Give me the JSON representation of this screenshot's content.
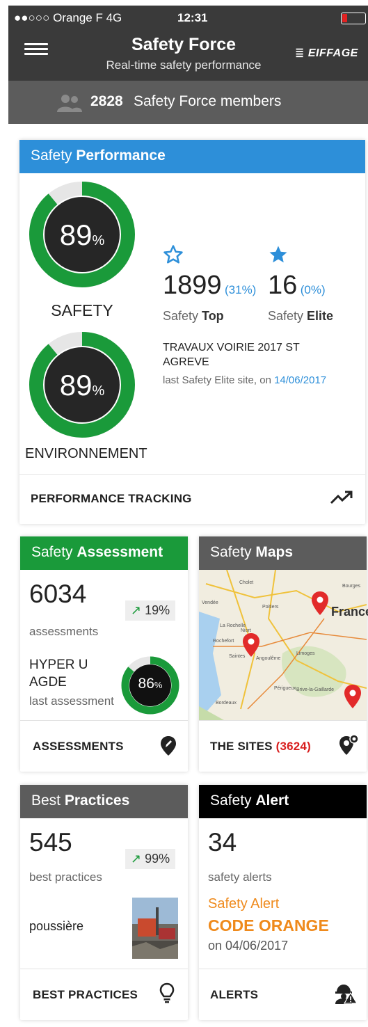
{
  "status_bar": {
    "carrier": "●●○○○ Orange F  4G",
    "time": "12:31"
  },
  "header": {
    "title": "Safety Force",
    "subtitle": "Real-time safety performance",
    "brand": "EIFFAGE",
    "menu_icon": "hamburger-icon"
  },
  "members": {
    "count": "2828",
    "label": "Safety Force members",
    "icon": "users-icon"
  },
  "performance": {
    "head_light": "Safety ",
    "head_bold": "Performance",
    "safety": {
      "value": "89",
      "unit": "%",
      "label": "SAFETY",
      "percent": 89
    },
    "environment": {
      "value": "89",
      "unit": "%",
      "label": "ENVIRONNEMENT",
      "percent": 89
    },
    "top": {
      "count": "1899",
      "pct": "(31%)",
      "label_light": "Safety ",
      "label_bold": "Top"
    },
    "elite": {
      "count": "16",
      "pct": "(0%)",
      "label_light": "Safety ",
      "label_bold": "Elite"
    },
    "site_line1": "TRAVAUX VOIRIE 2017 ST",
    "site_line2": "AGREVE",
    "site_note": "last Safety Elite site, on ",
    "site_date": "14/06/2017",
    "footer": "PERFORMANCE TRACKING",
    "colors": {
      "header": "#2d8fd9",
      "ring": "#1a9a3a"
    }
  },
  "assessment": {
    "head_light": "Safety ",
    "head_bold": "Assessment",
    "count": "6034",
    "count_label": "assessments",
    "trend": "19%",
    "site_line1": "HYPER U",
    "site_line2": "AGDE",
    "site_note": "last assessment",
    "score": "86",
    "score_unit": "%",
    "score_percent": 86,
    "footer": "ASSESSMENTS",
    "colors": {
      "header": "#1a9a3a"
    }
  },
  "maps": {
    "head_light": "Safety ",
    "head_bold": "Maps",
    "map_labels": [
      "France",
      "Poitiers",
      "La Rochelle",
      "Angoulême",
      "Limoges",
      "Périgueux",
      "Brive-la-Gaillarde",
      "Bordeaux",
      "Cholet",
      "Bourges",
      "Rochefort",
      "Saintes",
      "Niort",
      "Vendée"
    ],
    "footer": "THE SITES",
    "footer_count": "(3624)",
    "colors": {
      "header": "#5c5c5c"
    }
  },
  "best_practices": {
    "head_light": "Best ",
    "head_bold": "Practices",
    "count": "545",
    "count_label": "best practices",
    "trend": "99%",
    "item": "poussière",
    "footer": "BEST PRACTICES",
    "colors": {
      "header": "#5c5c5c"
    }
  },
  "safety_alert": {
    "head_light": "Safety ",
    "head_bold": "Alert",
    "count": "34",
    "count_label": "safety alerts",
    "alert_title": "Safety Alert",
    "alert_code": "CODE ORANGE",
    "alert_date": "on 04/06/2017",
    "footer": "ALERTS",
    "colors": {
      "header": "#000000",
      "accent": "#ef8a1c"
    }
  }
}
